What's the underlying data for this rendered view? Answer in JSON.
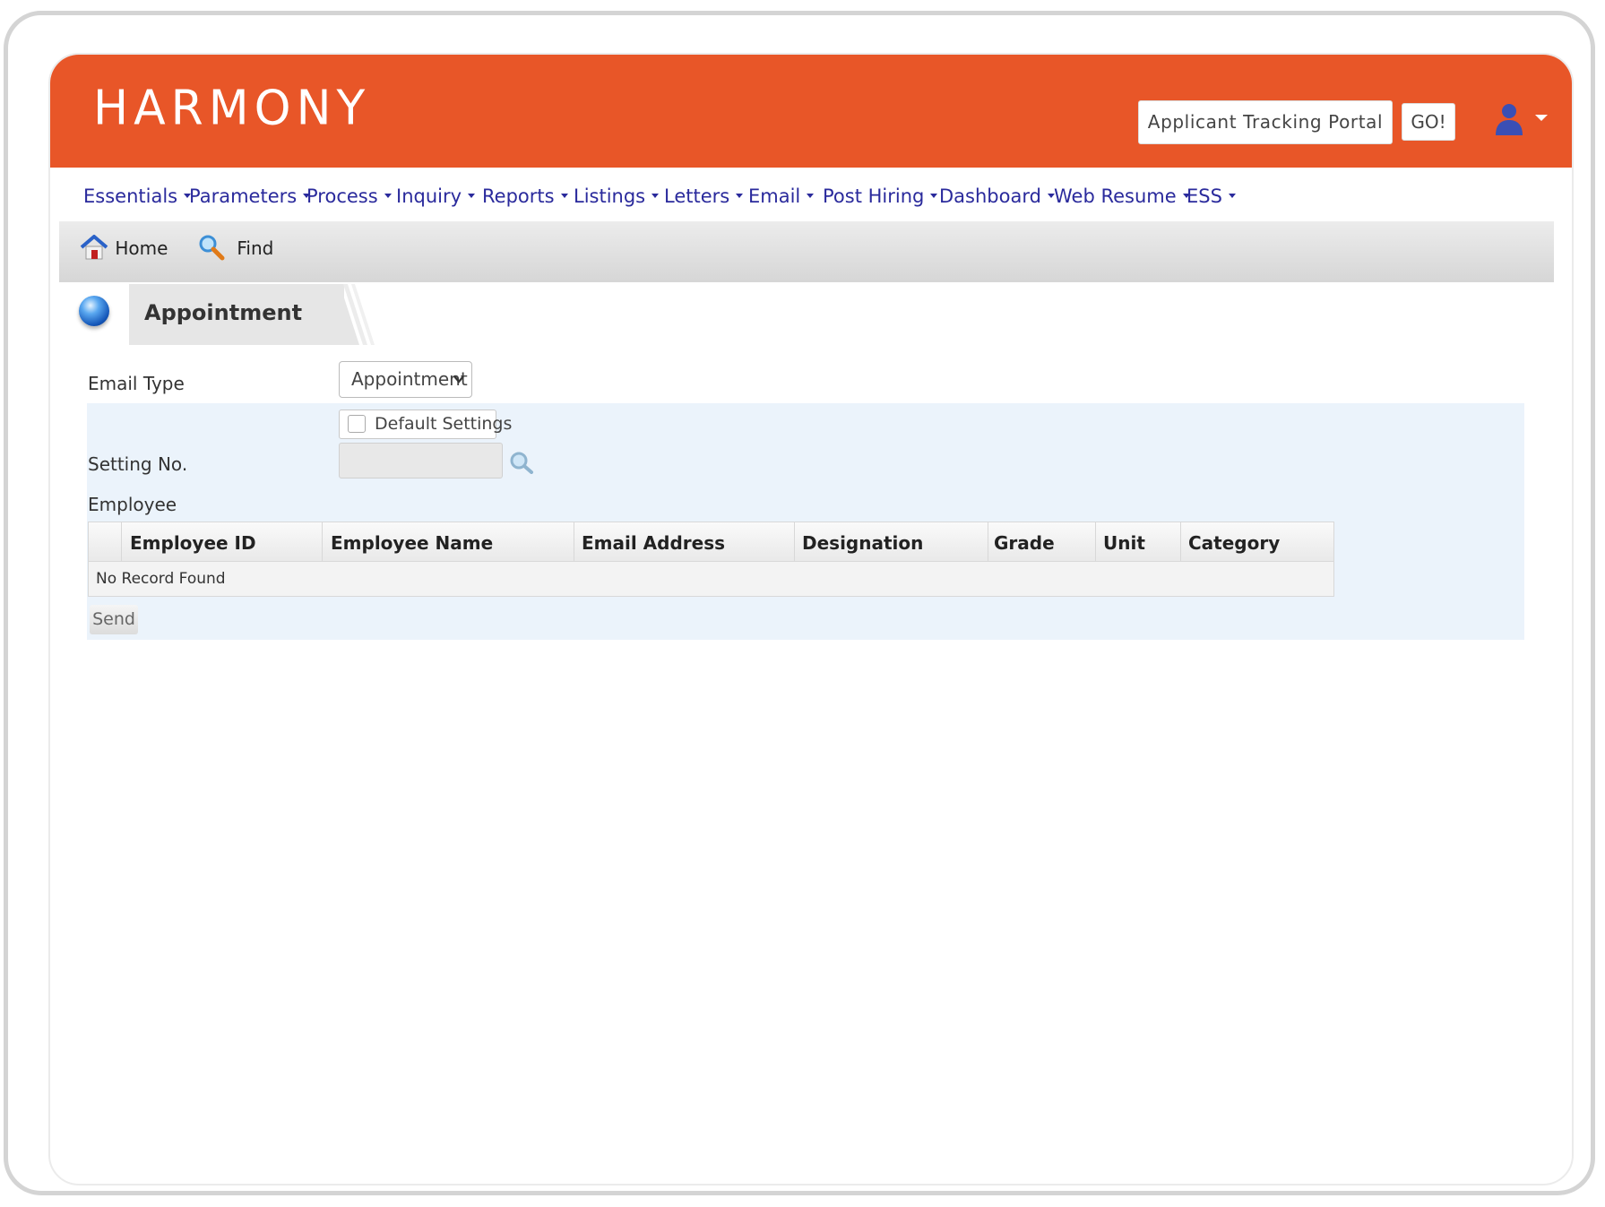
{
  "header": {
    "logo": "HARMONY",
    "portal_label": "Applicant Tracking Portal",
    "go_label": "GO!"
  },
  "menu": [
    {
      "label": "Essentials"
    },
    {
      "label": "Parameters"
    },
    {
      "label": "Process"
    },
    {
      "label": "Inquiry"
    },
    {
      "label": "Reports"
    },
    {
      "label": "Listings"
    },
    {
      "label": "Letters"
    },
    {
      "label": "Email"
    },
    {
      "label": "Post Hiring"
    },
    {
      "label": "Dashboard"
    },
    {
      "label": "Web Resume"
    },
    {
      "label": "ESS"
    }
  ],
  "toolbar": {
    "home_label": "Home",
    "find_label": "Find"
  },
  "page": {
    "title": "Appointment"
  },
  "form": {
    "email_type_label": "Email Type",
    "email_type_value": "Appointment",
    "default_settings_label": "Default Settings",
    "default_settings_checked": false,
    "setting_no_label": "Setting No.",
    "setting_no_value": "",
    "employee_label": "Employee"
  },
  "grid": {
    "columns": [
      "Employee ID",
      "Employee Name",
      "Email Address",
      "Designation",
      "Grade",
      "Unit",
      "Category"
    ],
    "empty_message": "No Record Found"
  },
  "actions": {
    "send_label": "Send"
  },
  "colors": {
    "brand": "#e85628",
    "menu_text": "#2a2a9c",
    "form_bg": "#ebf3fb"
  }
}
